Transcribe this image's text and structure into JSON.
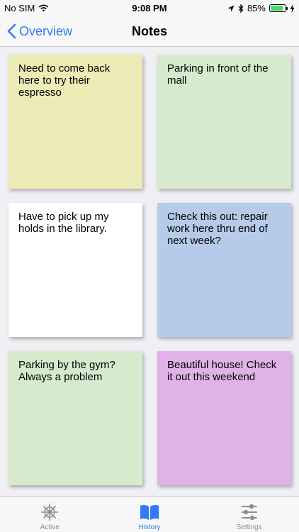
{
  "status_bar": {
    "carrier": "No SIM",
    "time": "9:08 PM",
    "battery_percent": "85%",
    "battery_level": 0.85,
    "icons": [
      "wifi-icon",
      "location-arrow-icon",
      "bluetooth-icon",
      "battery-icon",
      "charging-bolt-icon"
    ]
  },
  "nav": {
    "back_label": "Overview",
    "back_icon": "chevron-left-icon",
    "title": "Notes"
  },
  "notes": [
    {
      "text": "Need to come back here to try their espresso",
      "color": "#ecebb5"
    },
    {
      "text": "Parking in front of the mall",
      "color": "#d6ebce"
    },
    {
      "text": "Have to pick up my holds in the library.",
      "color": "#ffffff"
    },
    {
      "text": "Check this out: repair work here thru end of next week?",
      "color": "#b5cbe9"
    },
    {
      "text": "Parking by the gym? Always a problem",
      "color": "#d6ebce"
    },
    {
      "text": "Beautiful house! Check it out this weekend",
      "color": "#e1b2e8"
    }
  ],
  "tabs": [
    {
      "label": "Active",
      "icon": "ship-wheel-icon",
      "selected": false
    },
    {
      "label": "History",
      "icon": "open-book-icon",
      "selected": true
    },
    {
      "label": "Settings",
      "icon": "sliders-icon",
      "selected": false
    }
  ],
  "colors": {
    "accent": "#2f7cf6",
    "inactive_tab": "#8e8e93",
    "battery_fill": "#4cd964"
  }
}
